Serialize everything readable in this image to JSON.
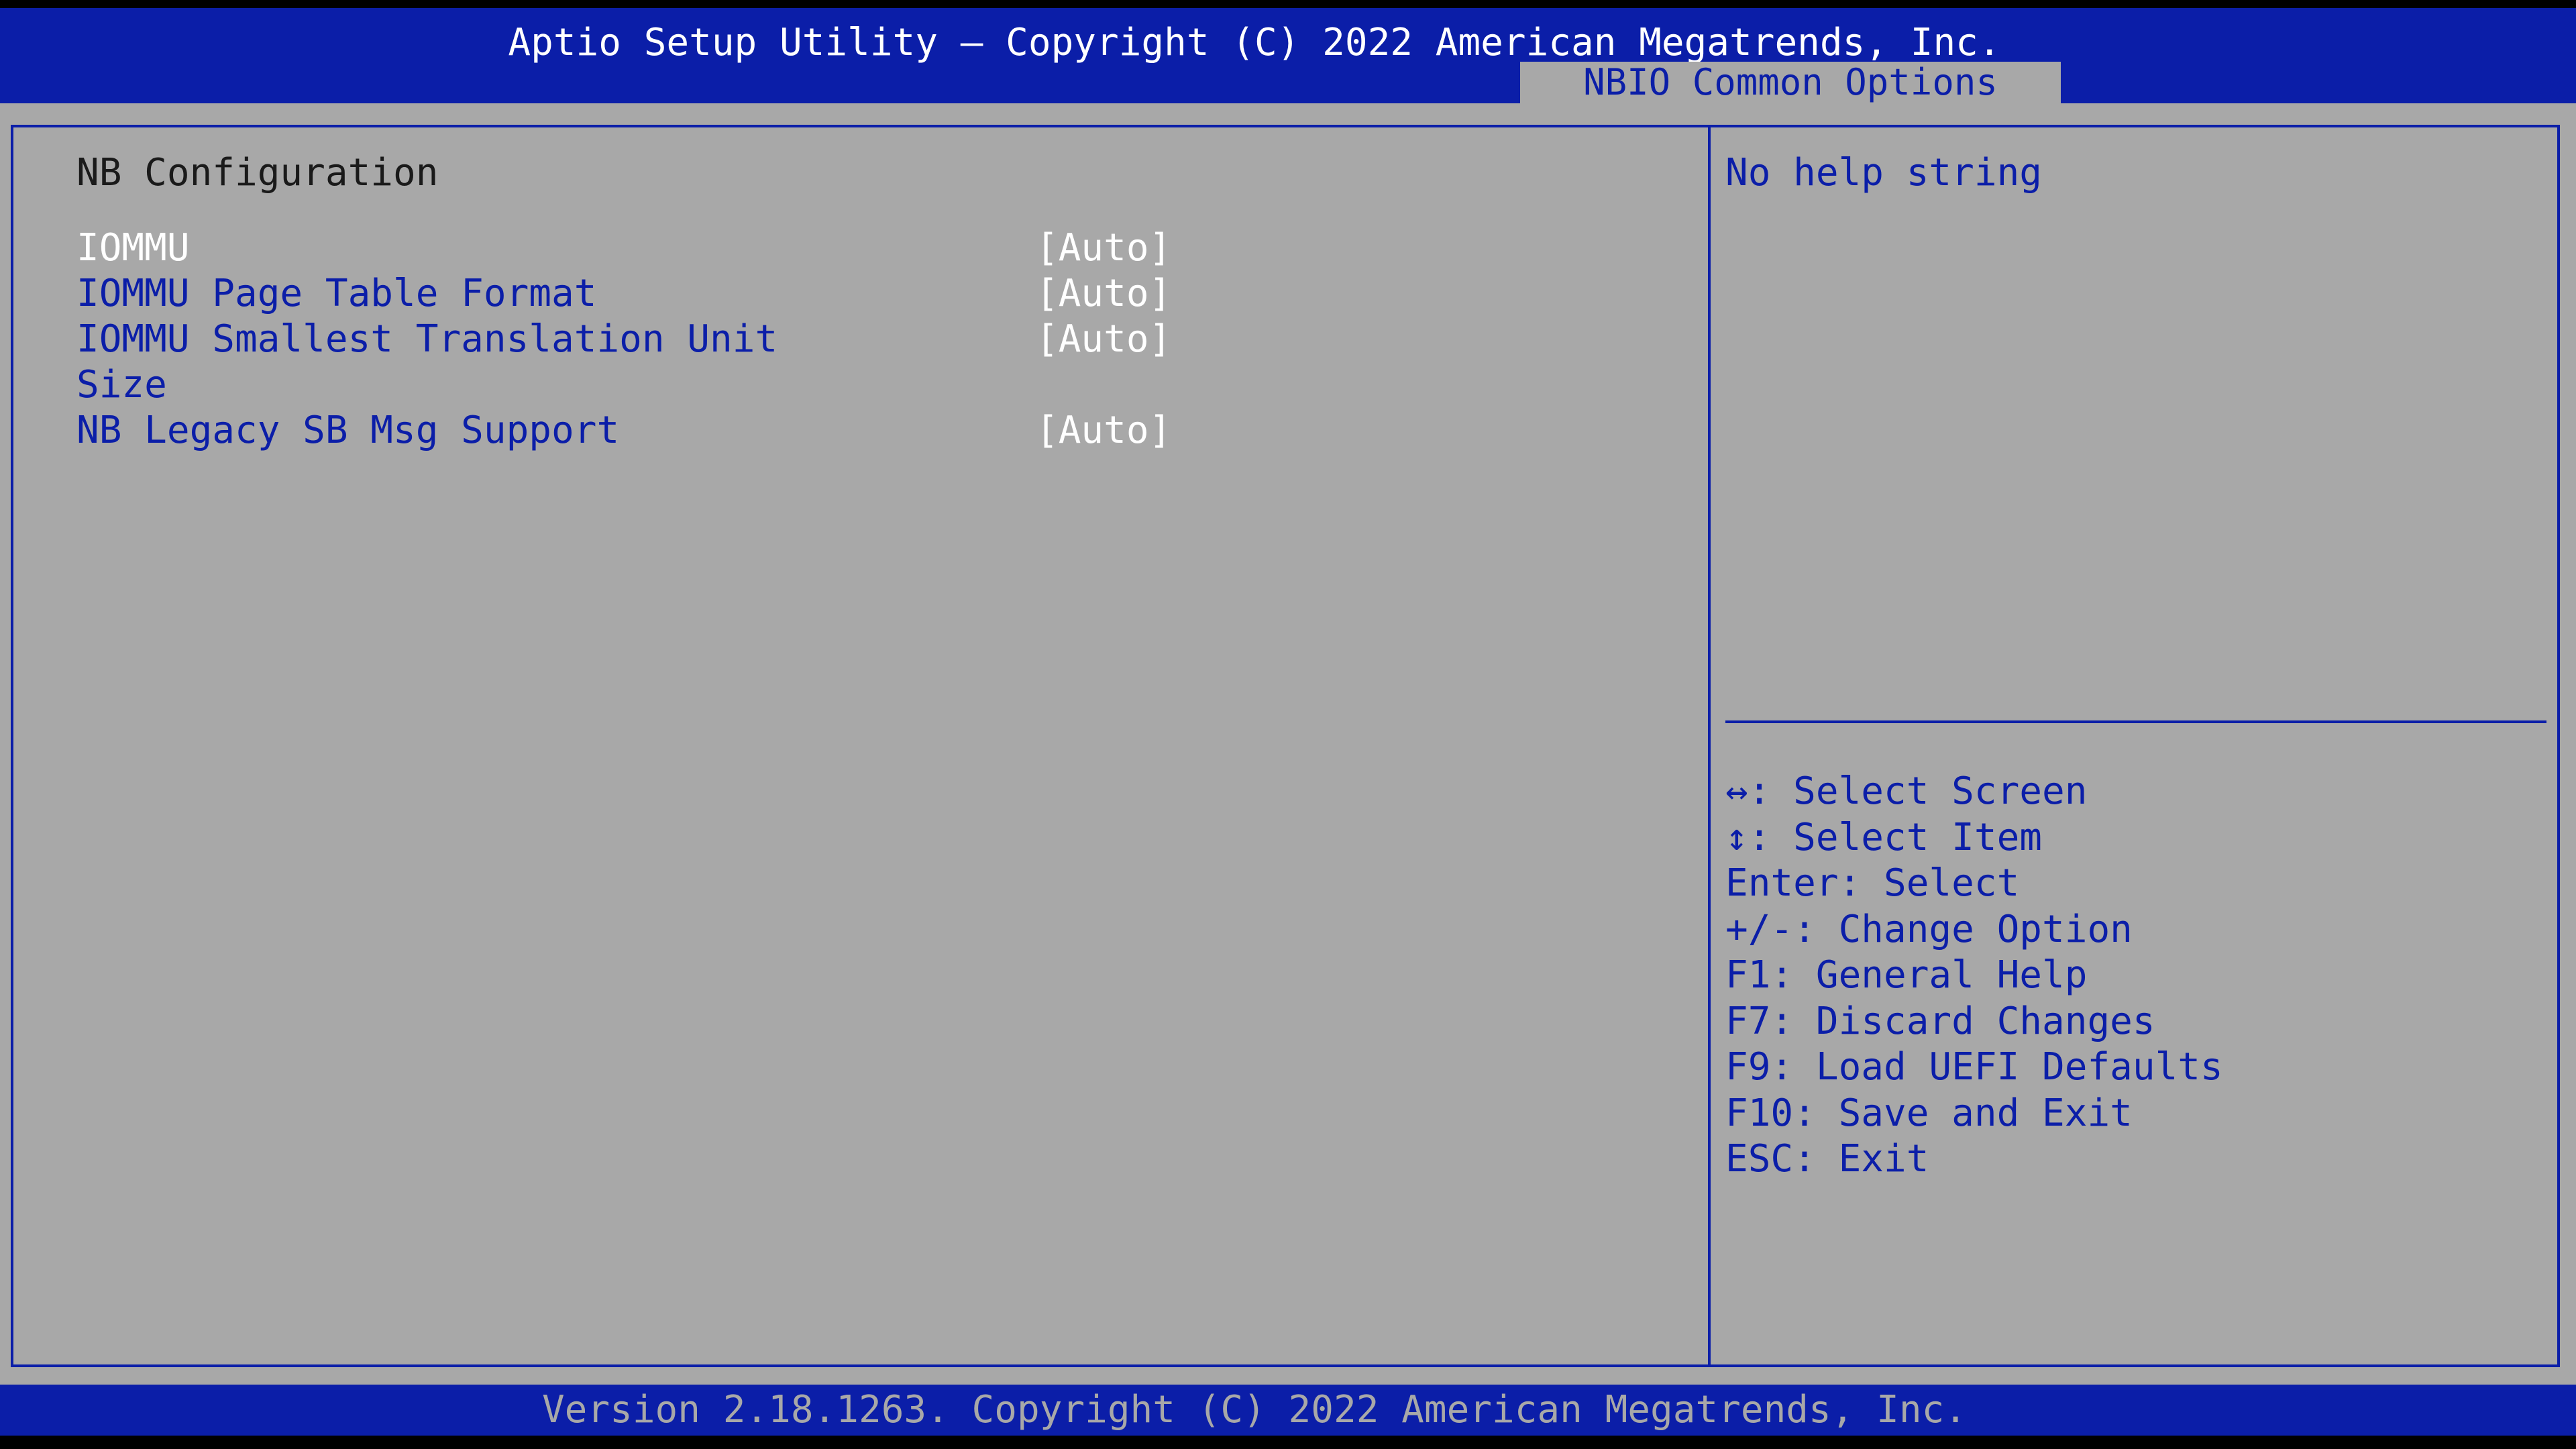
{
  "header": {
    "title": "Aptio Setup Utility – Copyright (C) 2022 American Megatrends, Inc.",
    "active_tab": "NBIO Common Options"
  },
  "main": {
    "section_title": "NB Configuration",
    "settings": [
      {
        "label": "IOMMU",
        "value": "[Auto]",
        "selected": true
      },
      {
        "label": "IOMMU Page Table Format",
        "value": "[Auto]",
        "selected": false
      },
      {
        "label": "IOMMU Smallest Translation Unit",
        "label_line2": "Size",
        "value": "[Auto]",
        "selected": false
      },
      {
        "label": "NB Legacy SB Msg Support",
        "value": "[Auto]",
        "selected": false
      }
    ]
  },
  "help": {
    "text": "No help string",
    "keys": [
      "↔: Select Screen",
      "↕: Select Item",
      "Enter: Select",
      "+/-: Change Option",
      "F1: General Help",
      "F7: Discard Changes",
      "F9: Load UEFI Defaults",
      "F10: Save and Exit",
      "ESC: Exit"
    ]
  },
  "footer": {
    "text": "Version 2.18.1263. Copyright (C) 2022 American Megatrends, Inc."
  },
  "colors": {
    "bios_blue": "#0b1ea8",
    "panel_gray": "#a8a8a8",
    "selected_white": "#ffffff"
  }
}
